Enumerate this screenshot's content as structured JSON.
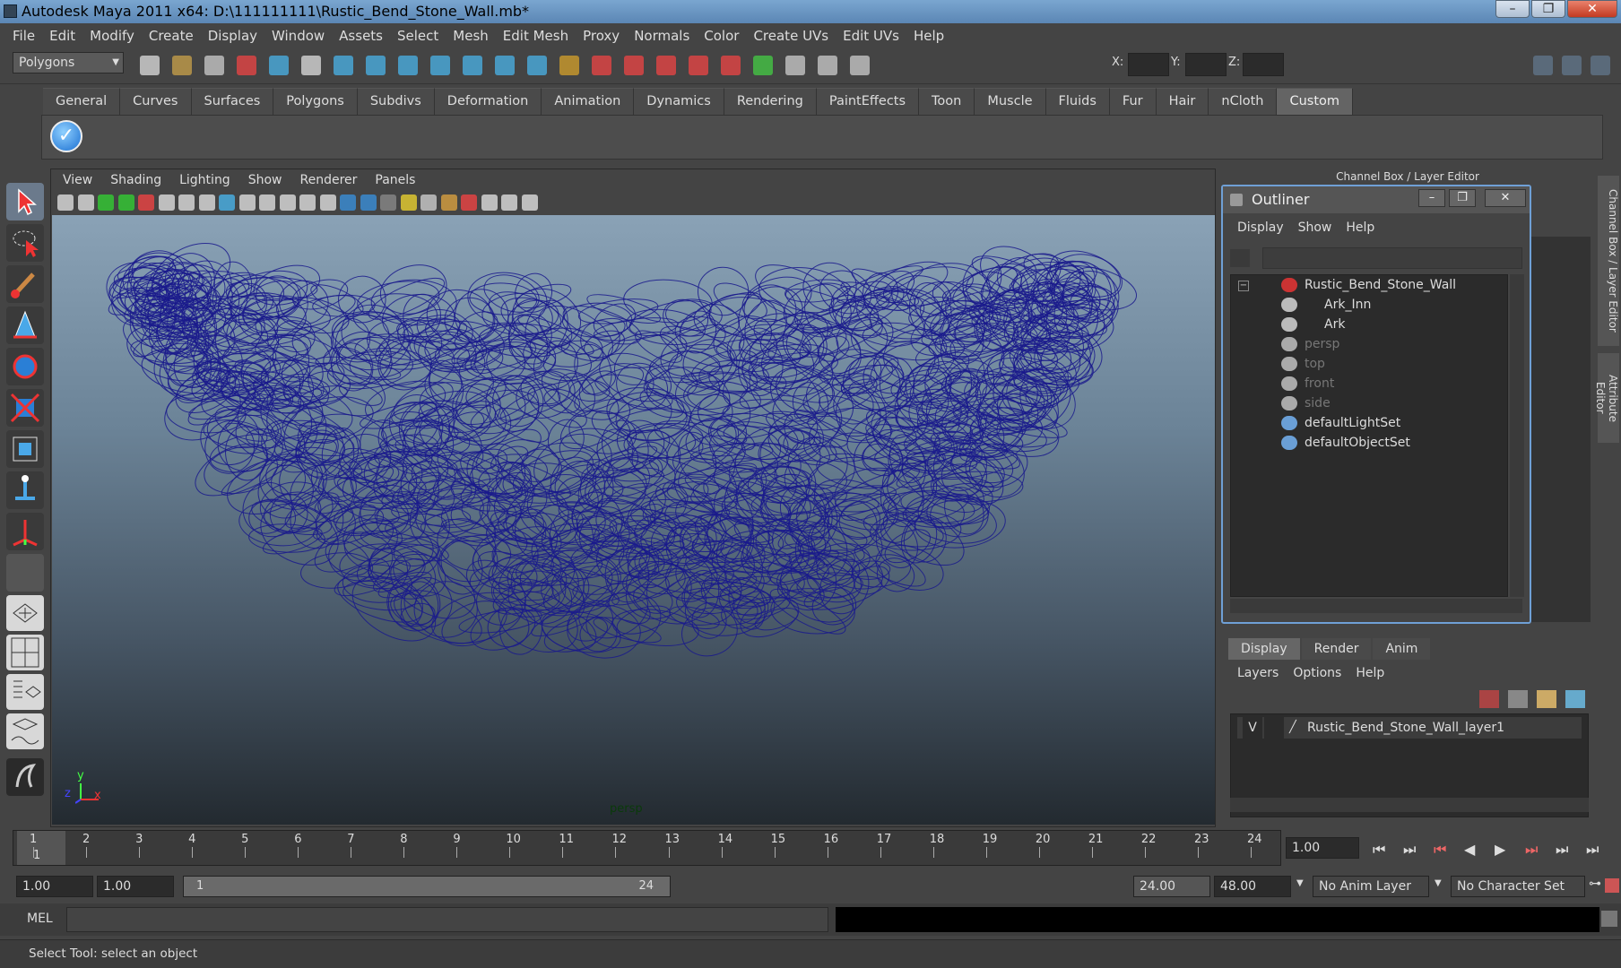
{
  "window": {
    "title": "Autodesk Maya 2011 x64: D:\\111111111\\Rustic_Bend_Stone_Wall.mb*",
    "buttons": [
      "–",
      "❐",
      "✕"
    ]
  },
  "menubar": [
    "File",
    "Edit",
    "Modify",
    "Create",
    "Display",
    "Window",
    "Assets",
    "Select",
    "Mesh",
    "Edit Mesh",
    "Proxy",
    "Normals",
    "Color",
    "Create UVs",
    "Edit UVs",
    "Help"
  ],
  "toolbar": {
    "menuset": "Polygons",
    "x_label": "X:",
    "y_label": "Y:",
    "z_label": "Z:"
  },
  "shelf": {
    "tabs": [
      "General",
      "Curves",
      "Surfaces",
      "Polygons",
      "Subdivs",
      "Deformation",
      "Animation",
      "Dynamics",
      "Rendering",
      "PaintEffects",
      "Toon",
      "Muscle",
      "Fluids",
      "Fur",
      "Hair",
      "nCloth",
      "Custom"
    ],
    "active": "Custom"
  },
  "viewport": {
    "menu": [
      "View",
      "Shading",
      "Lighting",
      "Show",
      "Renderer",
      "Panels"
    ],
    "camera_label": "persp",
    "axis": {
      "x": "x",
      "y": "y",
      "z": "z"
    },
    "mesh_color": "#1a1a8c"
  },
  "channel_box": {
    "header": "Channel Box / Layer Editor"
  },
  "outliner": {
    "title": "Outliner",
    "menu": [
      "Display",
      "Show",
      "Help"
    ],
    "items": [
      {
        "label": "Rustic_Bend_Stone_Wall",
        "dim": false,
        "icon": "group-icon"
      },
      {
        "label": "Ark_Inn",
        "dim": false,
        "icon": "mesh-icon"
      },
      {
        "label": "Ark",
        "dim": false,
        "icon": "mesh-icon"
      },
      {
        "label": "persp",
        "dim": true,
        "icon": "camera-icon"
      },
      {
        "label": "top",
        "dim": true,
        "icon": "camera-icon"
      },
      {
        "label": "front",
        "dim": true,
        "icon": "camera-icon"
      },
      {
        "label": "side",
        "dim": true,
        "icon": "camera-icon"
      },
      {
        "label": "defaultLightSet",
        "dim": false,
        "icon": "set-icon"
      },
      {
        "label": "defaultObjectSet",
        "dim": false,
        "icon": "set-icon"
      }
    ]
  },
  "layer_editor": {
    "tabs": [
      "Display",
      "Render",
      "Anim"
    ],
    "active_tab": "Display",
    "menu": [
      "Layers",
      "Options",
      "Help"
    ],
    "layer": {
      "visible": "V",
      "name": "Rustic_Bend_Stone_Wall_layer1"
    }
  },
  "right_tabs": [
    "Channel Box / Layer Editor",
    "Attribute Editor"
  ],
  "timeline": {
    "frames": [
      "1",
      "2",
      "3",
      "4",
      "5",
      "6",
      "7",
      "8",
      "9",
      "10",
      "11",
      "12",
      "13",
      "14",
      "15",
      "16",
      "17",
      "18",
      "19",
      "20",
      "21",
      "22",
      "23",
      "24"
    ],
    "start_marker": "1",
    "current_frame": "1.00"
  },
  "range": {
    "start": "1.00",
    "playback_start": "1.00",
    "slider_start": "1",
    "slider_end": "24",
    "playback_end": "24.00",
    "end": "48.00",
    "anim_layer": "No Anim Layer",
    "character_set": "No Character Set"
  },
  "command": {
    "label": "MEL"
  },
  "help_line": "Select Tool: select an object"
}
